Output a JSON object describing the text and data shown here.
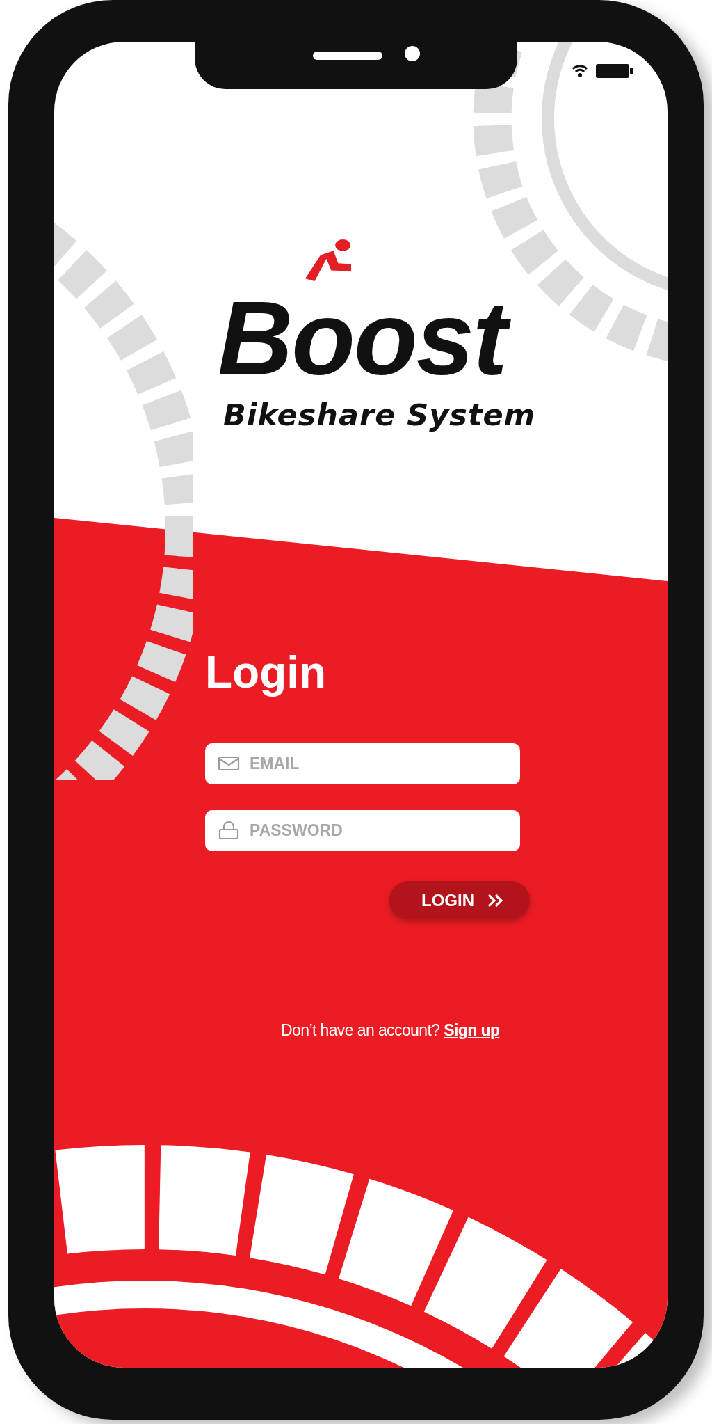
{
  "logo": {
    "wordmark": "Boost",
    "tagline": "Bikeshare System"
  },
  "login": {
    "title": "Login",
    "fields": [
      {
        "kind": "email",
        "placeholder": "EMAIL"
      },
      {
        "kind": "password",
        "placeholder": "PASSWORD"
      }
    ],
    "submit": {
      "label": "LOGIN"
    }
  },
  "signup": {
    "prompt": "Don’t have an account?",
    "link": "Sign up"
  }
}
